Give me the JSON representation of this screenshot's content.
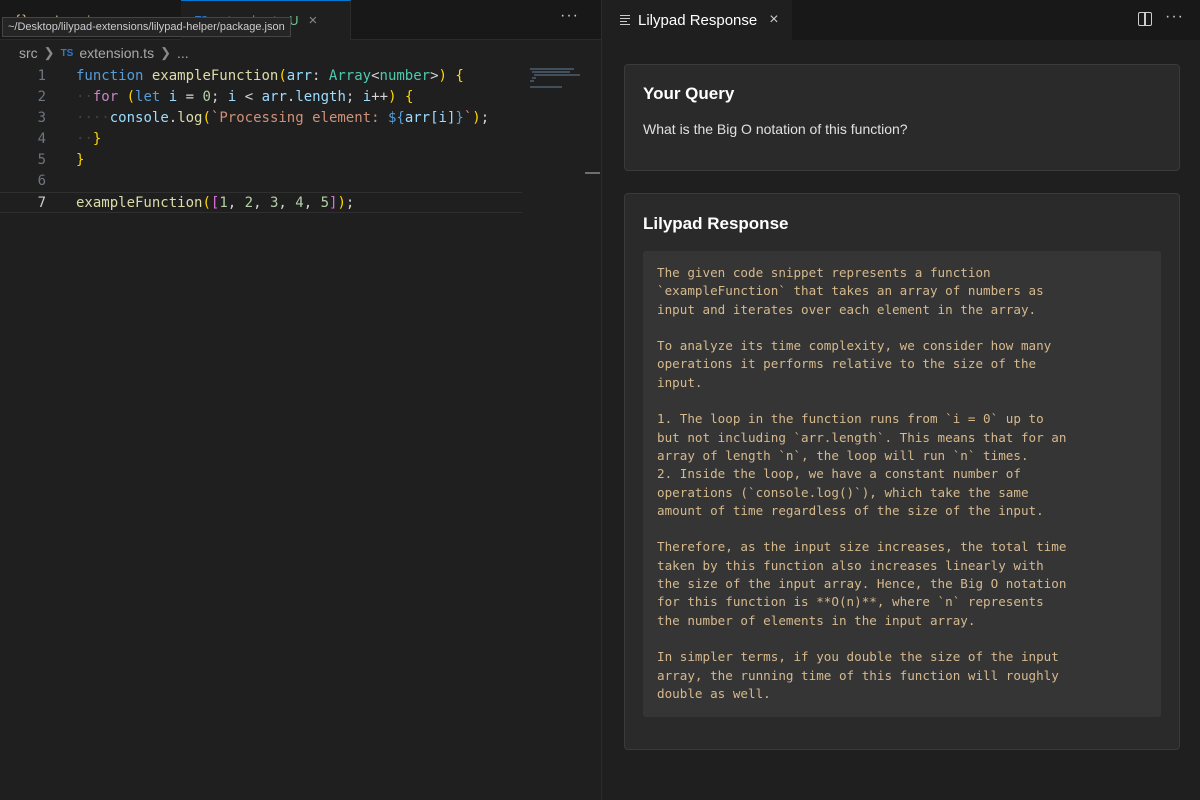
{
  "editor": {
    "tabs": [
      {
        "label": "package.json",
        "modified_dot": "",
        "close": "×"
      },
      {
        "label": "extension.ts",
        "status": "U",
        "close": "×"
      }
    ],
    "tab_more": "···",
    "tooltip": "~/Desktop/lilypad-extensions/lilypad-helper/package.json",
    "breadcrumb": {
      "folder": "src",
      "file_type": "TS",
      "file": "extension.ts",
      "more": "..."
    },
    "active_line": 7,
    "code_lines": [
      {
        "number": "1",
        "text": "function exampleFunction(arr: Array<number>) {"
      },
      {
        "number": "2",
        "text": "  for (let i = 0; i < arr.length; i++) {"
      },
      {
        "number": "3",
        "text": "    console.log(`Processing element: ${arr[i]}`);"
      },
      {
        "number": "4",
        "text": "  }"
      },
      {
        "number": "5",
        "text": "}"
      },
      {
        "number": "6",
        "text": ""
      },
      {
        "number": "7",
        "text": "exampleFunction([1, 2, 3, 4, 5]);"
      }
    ]
  },
  "panel": {
    "tab_label": "Lilypad Response",
    "tab_close": "×",
    "more": "···",
    "query": {
      "title": "Your Query",
      "text": "What is the Big O notation of this function?"
    },
    "response": {
      "title": "Lilypad Response",
      "body": "The given code snippet represents a function\n`exampleFunction` that takes an array of numbers as\ninput and iterates over each element in the array.\n\nTo analyze its time complexity, we consider how many\noperations it performs relative to the size of the\ninput.\n\n1. The loop in the function runs from `i = 0` up to\nbut not including `arr.length`. This means that for an\narray of length `n`, the loop will run `n` times.\n2. Inside the loop, we have a constant number of\noperations (`console.log()`), which take the same\namount of time regardless of the size of the input.\n\nTherefore, as the input size increases, the total time\ntaken by this function also increases linearly with\nthe size of the input array. Hence, the Big O notation\nfor this function is **O(n)**, where `n` represents\nthe number of elements in the input array.\n\nIn simpler terms, if you double the size of the input\narray, the running time of this function will roughly\ndouble as well."
    }
  },
  "colors": {
    "accent": "#0078d4",
    "response_text": "#d6b98c",
    "untracked": "#73c991"
  }
}
